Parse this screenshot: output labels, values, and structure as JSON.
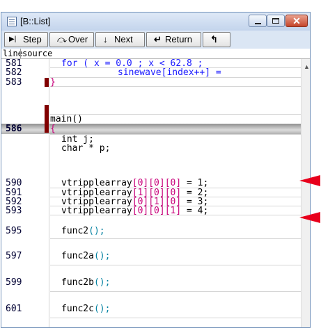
{
  "window": {
    "title": "[B::List]"
  },
  "toolbar": {
    "step": "Step",
    "over": "Over",
    "next": "Next",
    "return": "Return",
    "step_icon": "▶|",
    "over_icon": "⤼",
    "next_icon": "↓",
    "return_icon": "↵",
    "more_icon": "↰"
  },
  "header": {
    "line": "line",
    "source": "source"
  },
  "lines": {
    "l581": "581",
    "l582": "582",
    "l583": "583",
    "l586": "586",
    "l590": "590",
    "l591": "591",
    "l592": "592",
    "l593": "593",
    "l595": "595",
    "l597": "597",
    "l599": "599",
    "l601": "601"
  },
  "code": {
    "for_kw": "for",
    "for_rest": " ( x = 0.0 ; x < 62.8 ;",
    "sine": "sinewave[index++] =",
    "brace_close": "}",
    "main": "main()",
    "brace_open": "{",
    "int_j": "int j;",
    "char_p": "char * p;",
    "v590_a": "vtripplearray",
    "v590_b": "[0][0][0]",
    "v590_c": " = 1;",
    "v591_a": "vtripplearray",
    "v591_b": "[1][0][0]",
    "v591_c": " = 2;",
    "v592_a": "vtripplearray",
    "v592_b": "[0][1][0]",
    "v592_c": " = 3;",
    "v593_a": "vtripplearray",
    "v593_b": "[0][0][1]",
    "v593_c": " = 4;",
    "f595": "func2",
    "f597": "func2a",
    "f599": "func2b",
    "f601": "func2c",
    "call": "();"
  },
  "colors": {
    "highlight_arrow": "#e8001c",
    "breakpoint": "#800000"
  }
}
